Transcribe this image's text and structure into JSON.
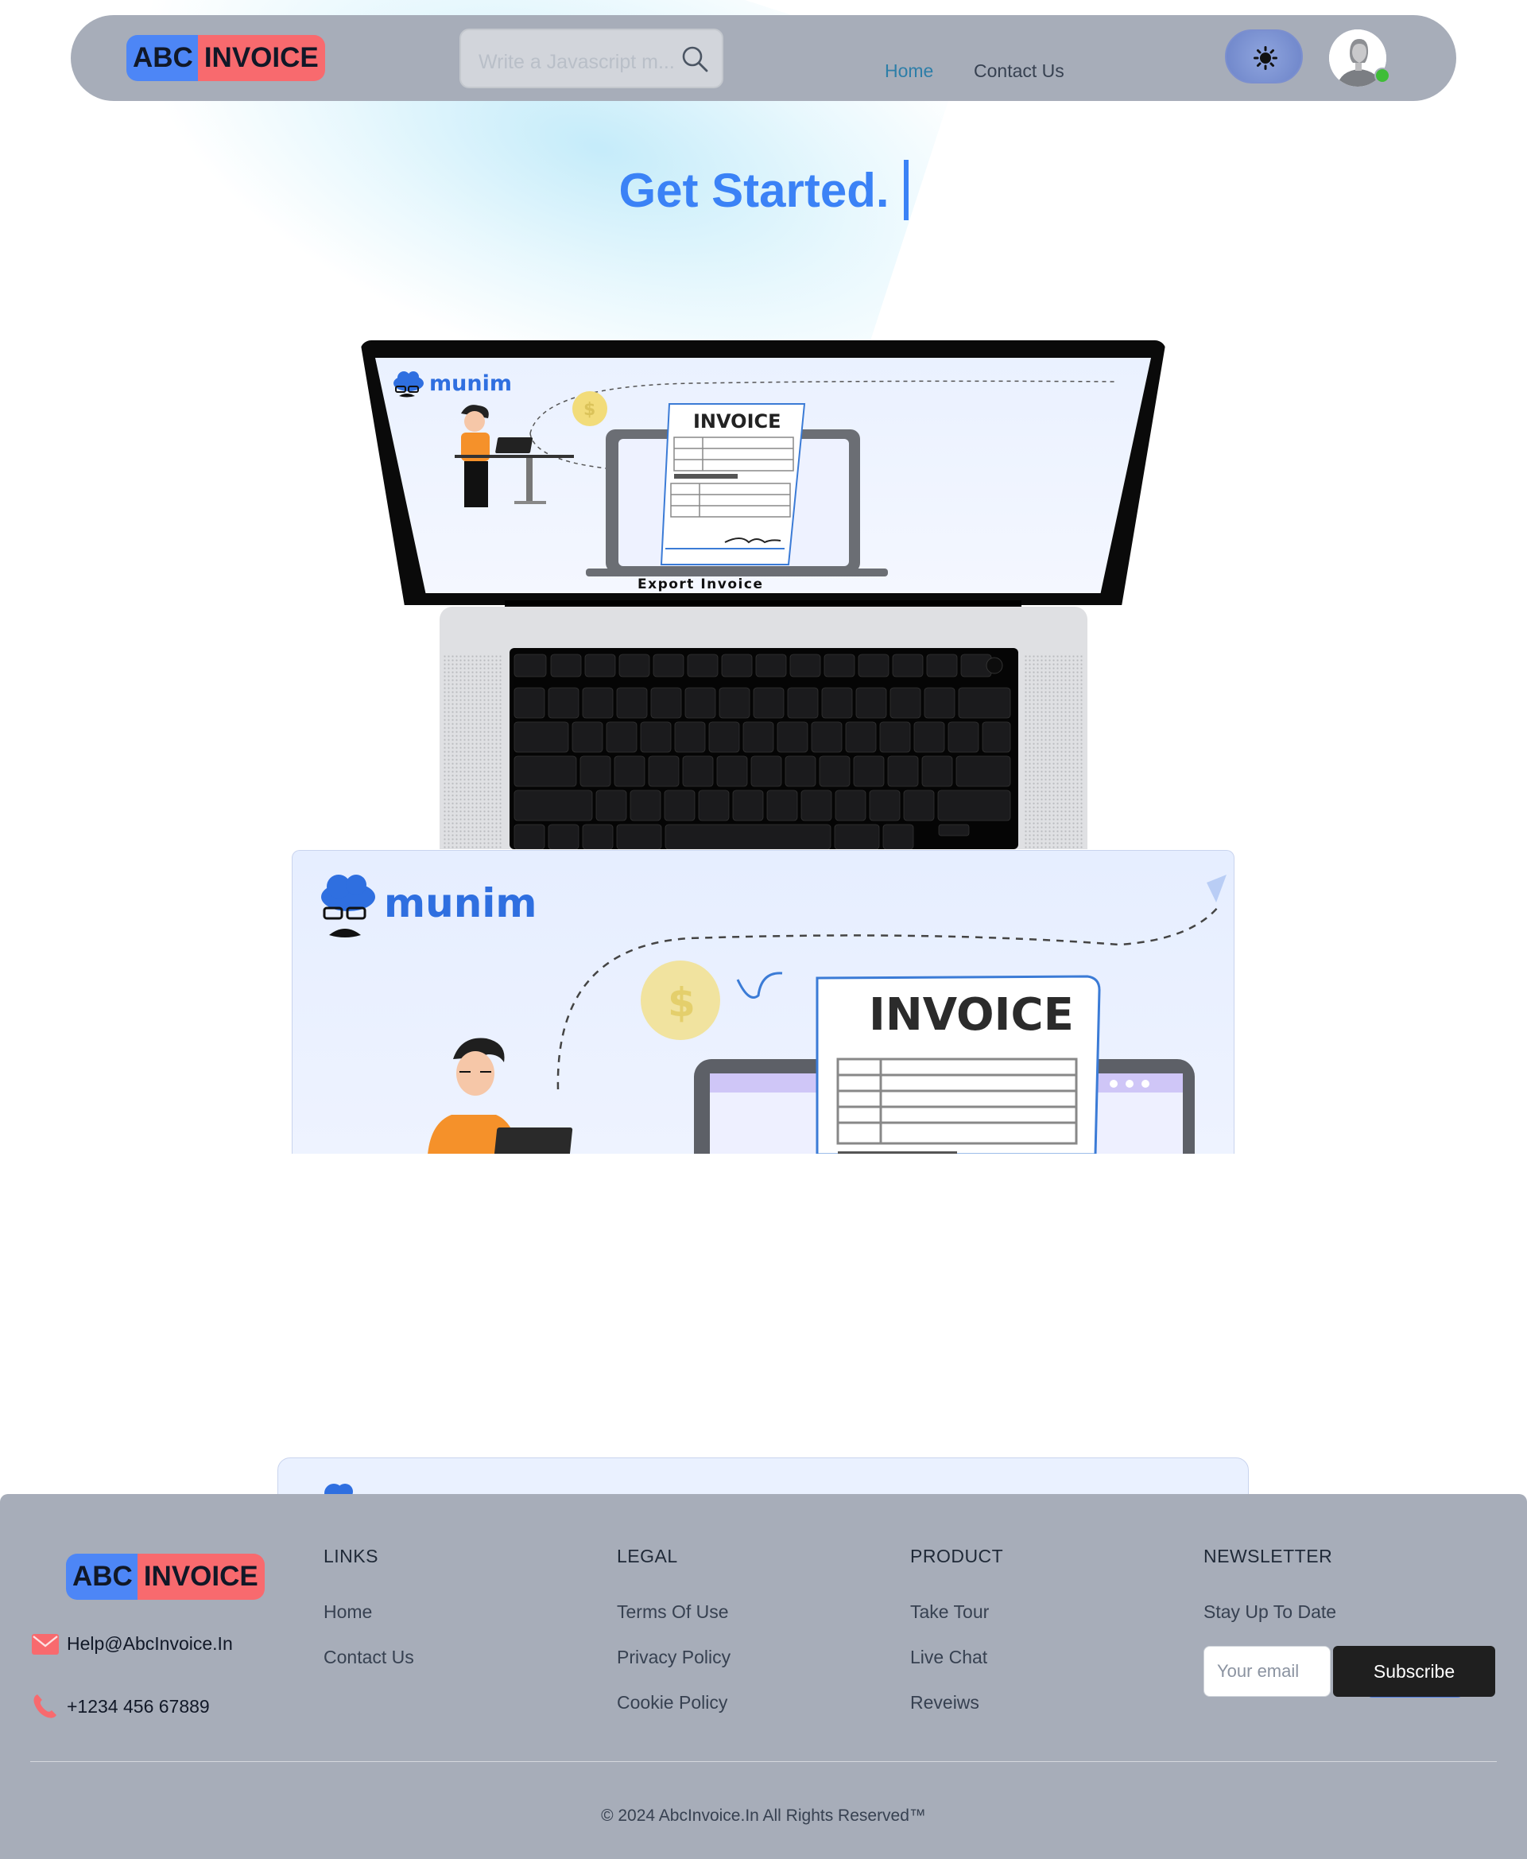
{
  "brand": {
    "abc": "ABC",
    "invoice": "INVOICE"
  },
  "nav": {
    "search_placeholder": "Write a Javascript m...",
    "links": [
      "Home",
      "Contact Us"
    ],
    "theme_toggle_icon": "sun-icon",
    "avatar_icon": "user-avatar"
  },
  "hero": {
    "title": "Get Started."
  },
  "illustration": {
    "app_name": "munim",
    "doc_title": "INVOICE",
    "caption": "Export Invoice",
    "currency_symbol": "$"
  },
  "footer": {
    "email": "Help@AbcInvoice.In",
    "phone": "+1234 456 67889",
    "columns": {
      "links": {
        "title": "LINKS",
        "items": [
          "Home",
          "Contact Us"
        ]
      },
      "legal": {
        "title": "LEGAL",
        "items": [
          "Terms Of Use",
          "Privacy Policy",
          "Cookie Policy"
        ]
      },
      "product": {
        "title": "PRODUCT",
        "items": [
          "Take Tour",
          "Live Chat",
          "Reveiws"
        ]
      },
      "newsletter": {
        "title": "NEWSLETTER",
        "subtitle": "Stay Up To Date",
        "placeholder": "Your email",
        "button": "Subscribe"
      }
    },
    "copyright": "© 2024 AbcInvoice.In All Rights Reserved™"
  },
  "colors": {
    "accent": "#3b82f6",
    "brand_blue": "#4d86f6",
    "brand_red": "#f86a6e",
    "nav_bg": "#a7adb9",
    "online": "#3fbd37"
  }
}
